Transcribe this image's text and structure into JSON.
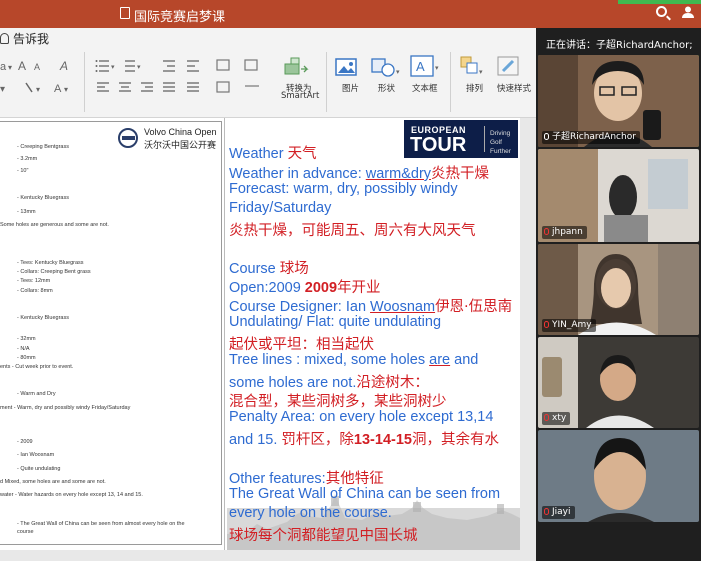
{
  "app": {
    "title": "国际竞赛启梦课",
    "accent": "#b7472a"
  },
  "ribbon": {
    "tell_me": "告诉我",
    "convert_smartart": "转换为",
    "convert_smartart_2": "SmartArt",
    "picture": "图片",
    "shape": "形状",
    "textbox": "文本框",
    "arrange": "排列",
    "quick_styles": "快速样式"
  },
  "left_doc": {
    "title_en": "Volvo China Open",
    "title_cn": "沃尔沃中国公开赛",
    "rows": [
      "-  Creeping Bentgrass",
      "-  3.2mm",
      "-  10\"",
      "-  Kentucky Bluegrass",
      "-  13mm",
      "Some holes are generous and some are not.",
      "-  Tees: Kentucky Bluegrass",
      "-  Collars: Creeping Bent grass",
      "-  Tees: 12mm",
      "-  Collars: 8mm",
      "-  Kentucky Bluegrass",
      "-  32mm",
      "-  N/A",
      "-  80mm",
      "ents   -  Cut week prior to event.",
      "-  Warm and Dry",
      "ment   -  Warm, dry and possibly windy Friday/Saturday",
      "-  2009",
      "-  Ian Woosnam",
      "-  Quite undulating",
      "d       Mixed, some holes are and some are not.",
      "water  -  Water hazards on every hole except 13, 14 and 15.",
      "-   The Great Wall of China can be seen from almost every hole on the",
      "course"
    ]
  },
  "logo": {
    "european": "EUROPEAN",
    "tour": "TOUR",
    "tagline1": "Driving",
    "tagline2": "Golf",
    "tagline3": "Further"
  },
  "slide": {
    "l1a": "Weather ",
    "l1b": "天气",
    "l2a": "Weather in advance: ",
    "l2b": "warm&dry",
    "l2c": "炎热干燥",
    "l3": "Forecast: warm, dry, possibly windy",
    "l4": "Friday/Saturday",
    "l5": "炎热干燥，可能周五、周六有大风天气",
    "l6a": "Course ",
    "l6b": "球场",
    "l7a": "Open:2009 ",
    "l7b": "2009",
    "l7c": "年开业",
    "l8a": "Course Designer: Ian ",
    "l8b": "Woosnam",
    "l8c": "伊恩·伍思南",
    "l9": "Undulating/ Flat: quite undulating",
    "l10": "起伏或平坦：相当起伏",
    "l11a": "Tree lines : mixed, some  holes ",
    "l11b": "are",
    "l11c": " and",
    "l12a": "some holes are not.",
    "l12b": "沿途树木：",
    "l13": "混合型，某些洞树多，某些洞树少",
    "l14": "Penalty Area: on every hole except 13,14",
    "l15a": "and 15. ",
    "l15b": "罚杆区，除",
    "l15c": "13-14-15",
    "l15d": "洞，其余有水",
    "l16a": "Other features:",
    "l16b": "其他特征",
    "l17": "The Great Wall of China can be seen from",
    "l18": "every hole on the course.",
    "l19": "球场每个洞都能望见中国长城",
    "blue": "#2e6bd1",
    "red": "#d21f24"
  },
  "meeting": {
    "speaking": "正在讲话：子超RichardAnchor;",
    "participants": [
      {
        "name": "子超RichardAnchor",
        "muted": false
      },
      {
        "name": "jhpann",
        "muted": true
      },
      {
        "name": "YIN_Amy",
        "muted": true
      },
      {
        "name": "xty",
        "muted": true
      },
      {
        "name": "Jiayi",
        "muted": true
      }
    ]
  }
}
